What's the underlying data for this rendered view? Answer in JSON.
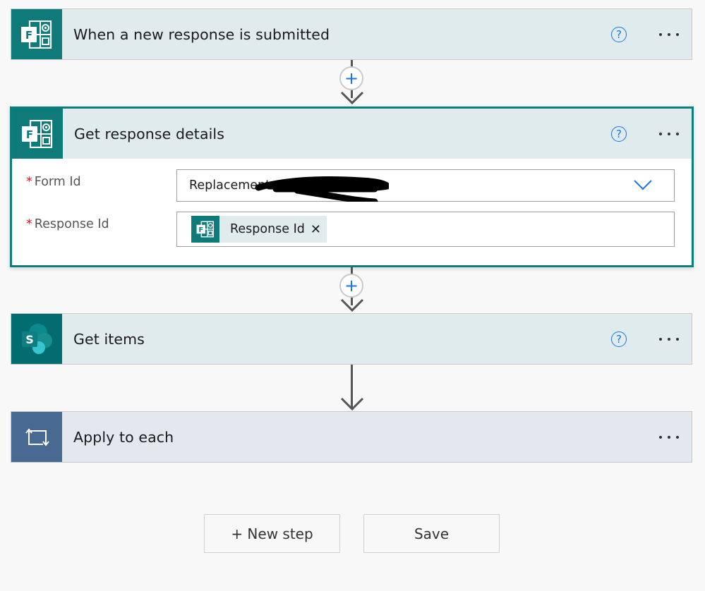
{
  "steps": [
    {
      "title": "When a new response is submitted",
      "icon": "forms-icon",
      "has_help": true
    },
    {
      "title": "Get response details",
      "icon": "forms-icon",
      "has_help": true,
      "fields": {
        "form_id": {
          "label": "Form Id",
          "required_mark": "*",
          "value": "Replacement",
          "redacted": true
        },
        "response_id": {
          "label": "Response Id",
          "required_mark": "*",
          "token_label": "Response Id",
          "token_remove": "✕"
        }
      }
    },
    {
      "title": "Get items",
      "icon": "sharepoint-icon",
      "has_help": true
    },
    {
      "title": "Apply to each",
      "icon": "loop-icon",
      "has_help": false
    }
  ],
  "icons": {
    "help": "?",
    "sharepoint_letter": "S",
    "forms_letter": "F",
    "plus": "+"
  },
  "buttons": {
    "new_step": "+ New step",
    "save": "Save"
  },
  "colors": {
    "forms": "#0f7a7a",
    "sharepoint": "#036c70",
    "loop": "#486991",
    "accent": "#1a73e8",
    "selected_border": "#0c7e7e"
  }
}
